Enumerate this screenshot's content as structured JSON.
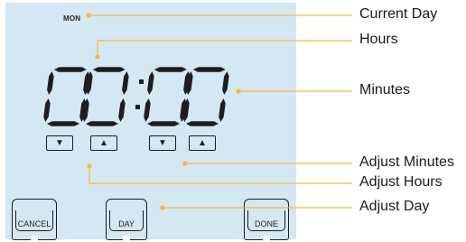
{
  "display": {
    "day": "MON",
    "hours": "00",
    "minutes": "00"
  },
  "buttons": {
    "cancel": "CANCEL",
    "day": "DAY",
    "done": "DONE",
    "arrow_down": "▼",
    "arrow_up": "▲"
  },
  "callouts": [
    "Current Day",
    "Hours",
    "Minutes",
    "Adjust Minutes",
    "Adjust Hours",
    "Adjust Day"
  ],
  "colors": {
    "panel": "#d3e8f3",
    "leader": "#f6b93b",
    "ink": "#1e1e1e"
  }
}
